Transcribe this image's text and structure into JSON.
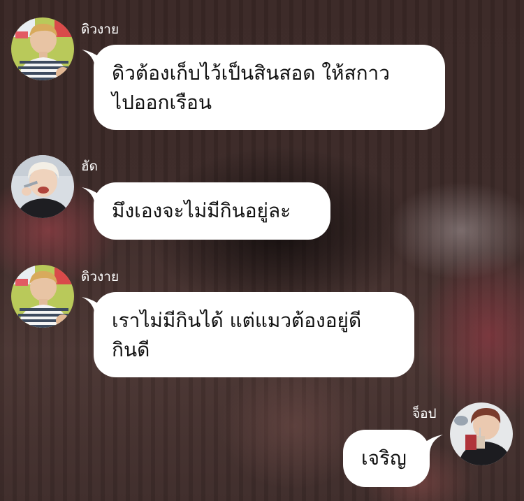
{
  "background": {
    "description_color": "#3c2a28"
  },
  "messages": [
    {
      "sender": "ดิวงาย",
      "side": "left",
      "avatar_icon": "user-avatar-striped-shirt",
      "lines": [
        "ดิวต้องเก็บไว้เป็นสินสอด ให้สกาว",
        "ไปออกเรือน"
      ]
    },
    {
      "sender": "ฮัด",
      "side": "left",
      "avatar_icon": "user-avatar-eating",
      "lines": [
        "มึงเองจะไม่มีกินอยู่ละ"
      ]
    },
    {
      "sender": "ดิวงาย",
      "side": "left",
      "avatar_icon": "user-avatar-striped-shirt",
      "lines": [
        "เราไม่มีกินได้ แต่แมวต้องอยู่ดี",
        "กินดี"
      ]
    },
    {
      "sender": "จ็อป",
      "side": "right",
      "avatar_icon": "user-avatar-drinking",
      "lines": [
        "เจริญ"
      ]
    }
  ],
  "colors": {
    "bubble": "#ffffff",
    "text": "#111111",
    "sender_name": "#ffffff"
  }
}
